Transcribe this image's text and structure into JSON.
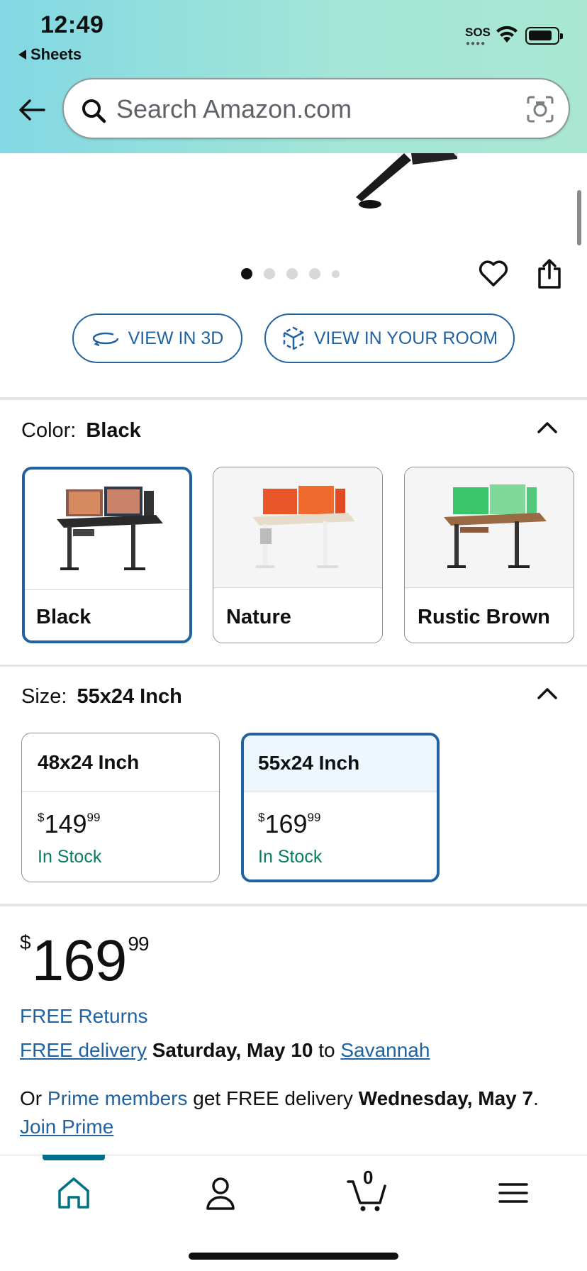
{
  "status_bar": {
    "time": "12:49",
    "back_app": "Sheets",
    "sos": "SOS"
  },
  "search": {
    "placeholder": "Search Amazon.com"
  },
  "gallery": {
    "dot_count": 5,
    "active_dot": 1
  },
  "view_buttons": {
    "view_3d": "VIEW IN 3D",
    "view_room": "VIEW IN YOUR ROOM"
  },
  "color_section": {
    "label": "Color:",
    "selected": "Black",
    "options": [
      {
        "label": "Black",
        "selected": true
      },
      {
        "label": "Nature",
        "selected": false
      },
      {
        "label": "Rustic Brown",
        "selected": false
      }
    ]
  },
  "size_section": {
    "label": "Size:",
    "selected": "55x24 Inch",
    "options": [
      {
        "label": "48x24 Inch",
        "currency": "$",
        "dollars": "149",
        "cents": "99",
        "stock": "In Stock",
        "selected": false
      },
      {
        "label": "55x24 Inch",
        "currency": "$",
        "dollars": "169",
        "cents": "99",
        "stock": "In Stock",
        "selected": true
      }
    ]
  },
  "price": {
    "currency": "$",
    "dollars": "169",
    "cents": "99"
  },
  "shipping": {
    "free_returns": "FREE Returns",
    "free_delivery": "FREE delivery",
    "delivery_date": "Saturday, May 10",
    "to": "to",
    "location": "Savannah",
    "prime_or": "Or",
    "prime_members": "Prime members",
    "prime_text": "get FREE delivery",
    "prime_date": "Wednesday, May 7",
    "period": ".",
    "join_prime": "Join Prime"
  },
  "bottom_nav": {
    "cart_count": "0"
  },
  "colors": {
    "link": "#2162a1",
    "in_stock": "#067d62",
    "selected_border": "#2162a1",
    "nav_accent": "#007185"
  }
}
